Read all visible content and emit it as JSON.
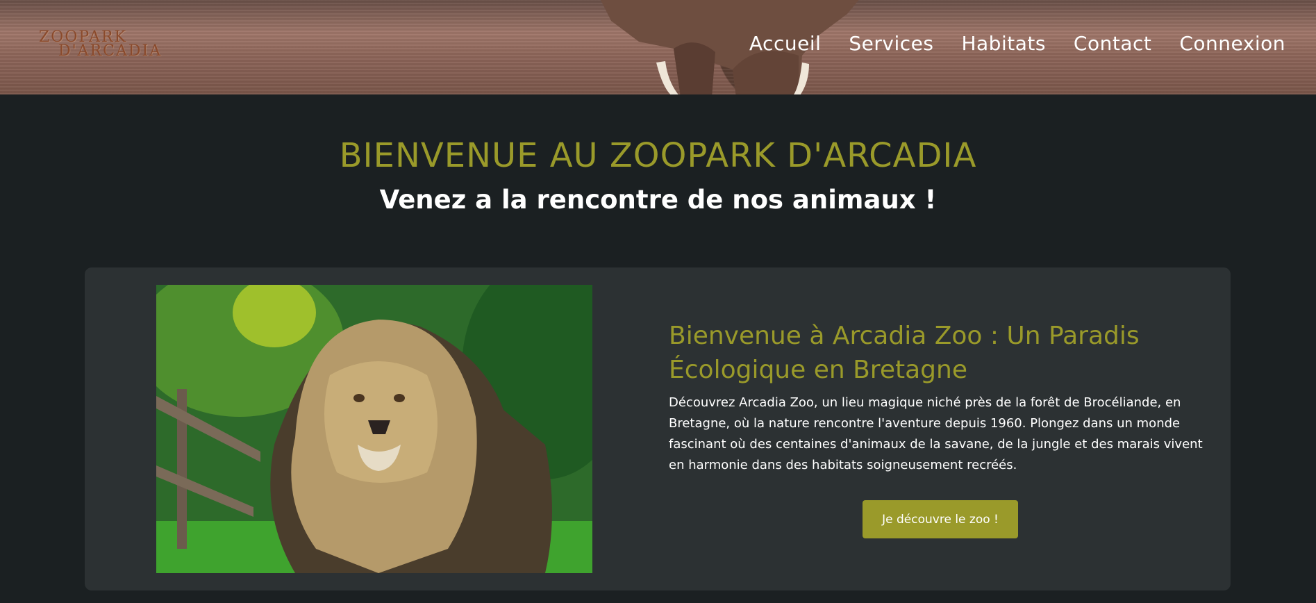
{
  "logo": {
    "line1": "ZOOPARK",
    "line2": "D'ARCADIA"
  },
  "nav": [
    "Accueil",
    "Services",
    "Habitats",
    "Contact",
    "Connexion"
  ],
  "hero": {
    "title": "BIENVENUE AU ZOOPARK D'ARCADIA",
    "subtitle": "Venez a la rencontre de nos animaux !"
  },
  "intro": {
    "title": "Bienvenue à Arcadia Zoo : Un Paradis Écologique en Bretagne",
    "text": "Découvrez Arcadia Zoo, un lieu magique niché près de la forêt de Brocéliande, en Bretagne, où la nature rencontre l'aventure depuis 1960. Plongez dans un monde fascinant où des centaines d'animaux de la savane, de la jungle et des marais vivent en harmonie dans des habitats soigneusement recréés.",
    "button": "Je découvre le zoo !"
  },
  "colors": {
    "accent": "#9a9a2a",
    "background": "#1b2022",
    "card": "#2c3133"
  }
}
